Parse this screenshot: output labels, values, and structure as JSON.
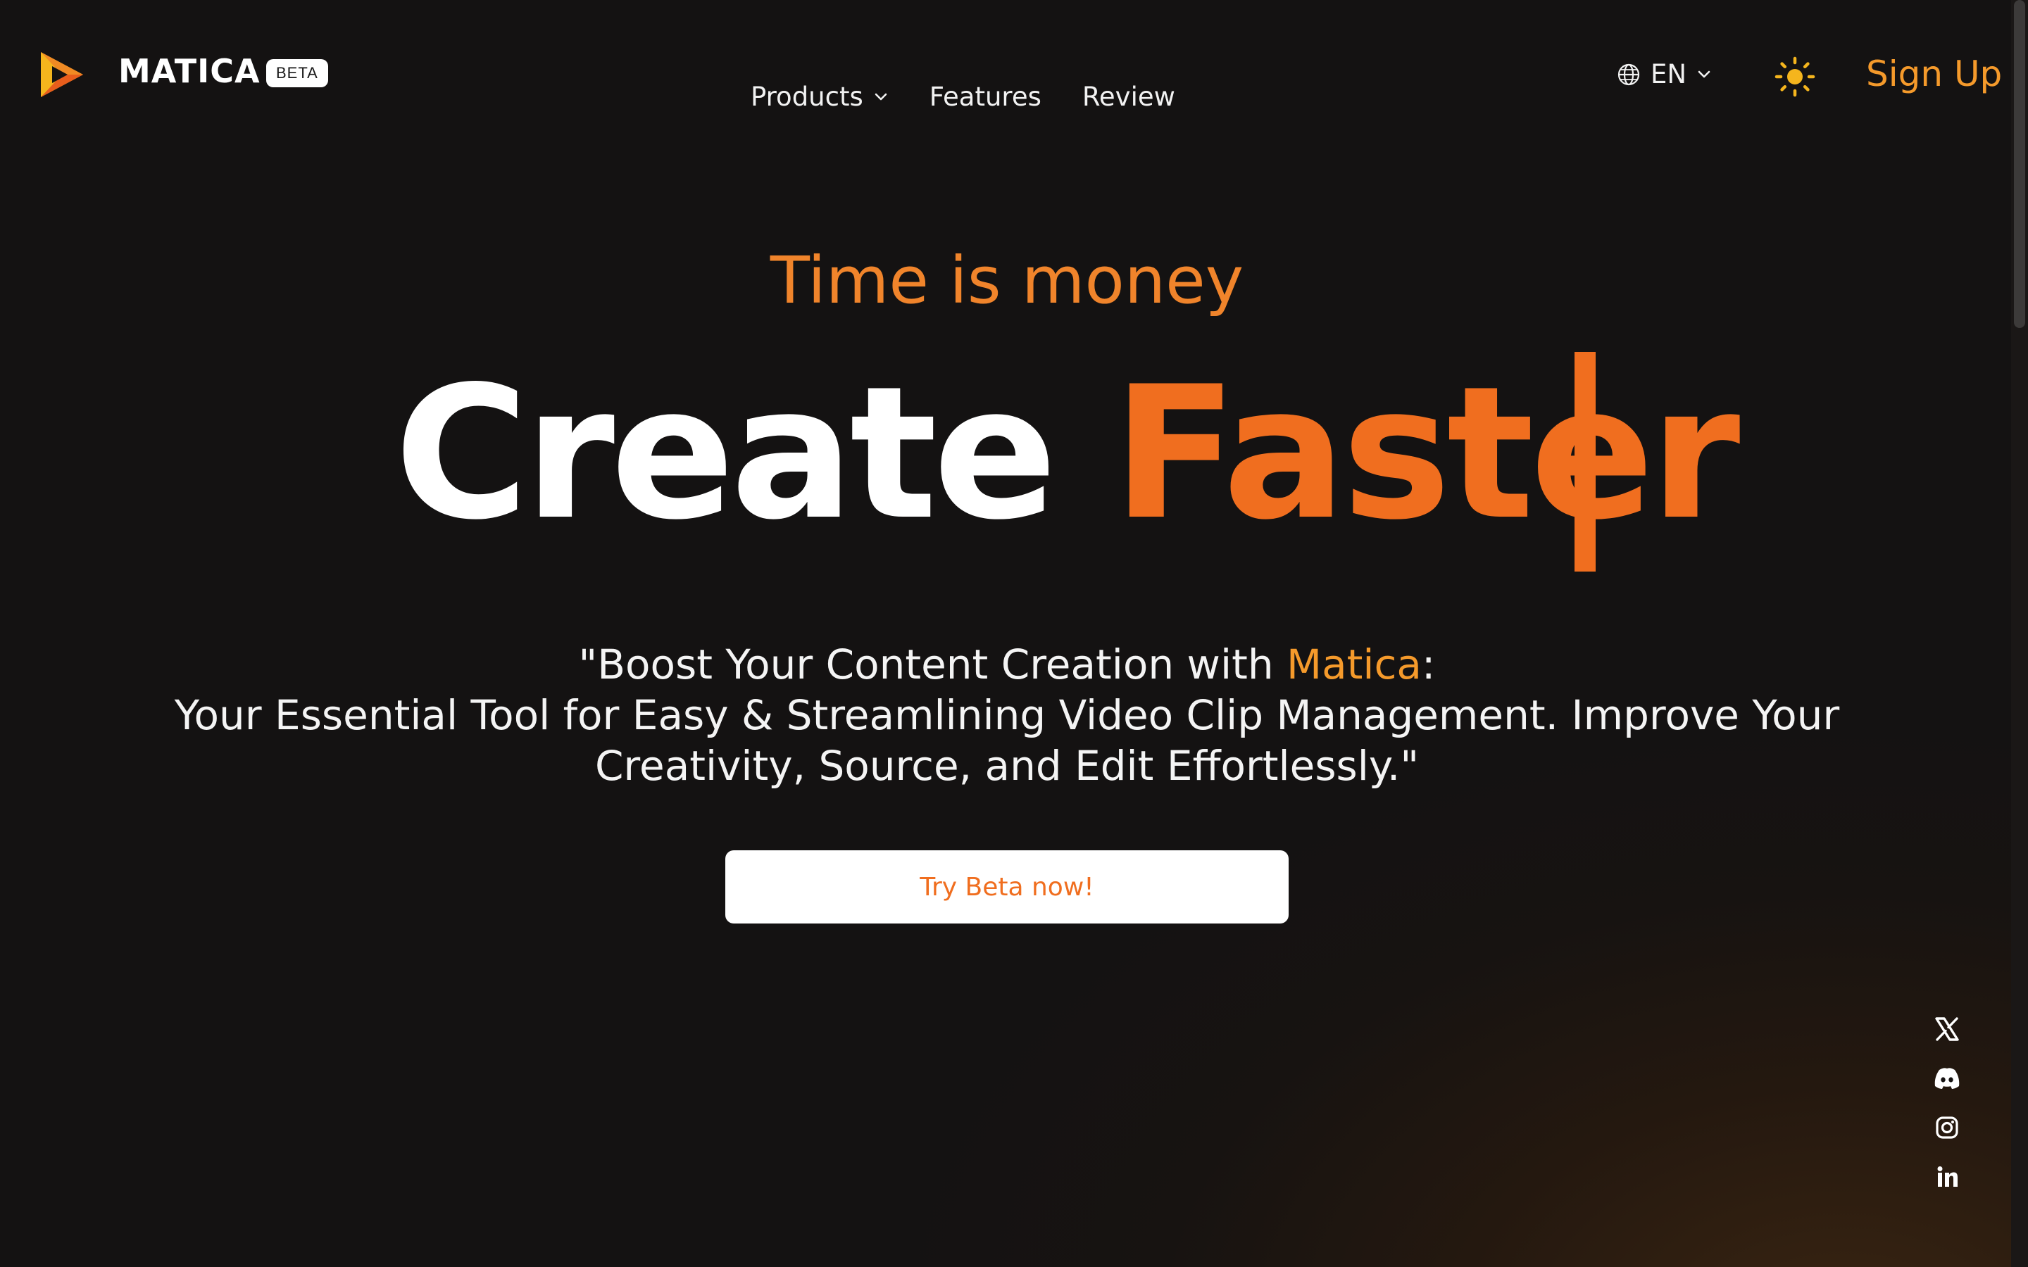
{
  "brand": {
    "name": "MATICA",
    "badge": "BETA"
  },
  "nav": {
    "items": [
      {
        "label": "Products",
        "has_dropdown": true
      },
      {
        "label": "Features"
      },
      {
        "label": "Review"
      }
    ]
  },
  "language": {
    "selected": "EN"
  },
  "header": {
    "signup_label": "Sign Up",
    "theme_icon": "sun-icon"
  },
  "hero": {
    "tagline": "Time is money",
    "headline_white": "Create",
    "headline_accent": "Faster",
    "sub_line1_prefix": "\"Boost Your Content Creation with ",
    "sub_line1_brand": "Matica",
    "sub_line1_suffix": ":",
    "sub_line2": "Your Essential Tool for Easy & Streamlining Video Clip Management. Improve Your",
    "sub_line3": "Creativity, Source, and Edit Effortlessly.\"",
    "cta_label": "Try Beta now!"
  },
  "social": [
    "x-icon",
    "discord-icon",
    "instagram-icon",
    "linkedin-icon"
  ],
  "colors": {
    "accent": "#f06e1f",
    "accent_light": "#f59a2b",
    "background": "#161312",
    "sun": "#f5b51d"
  }
}
